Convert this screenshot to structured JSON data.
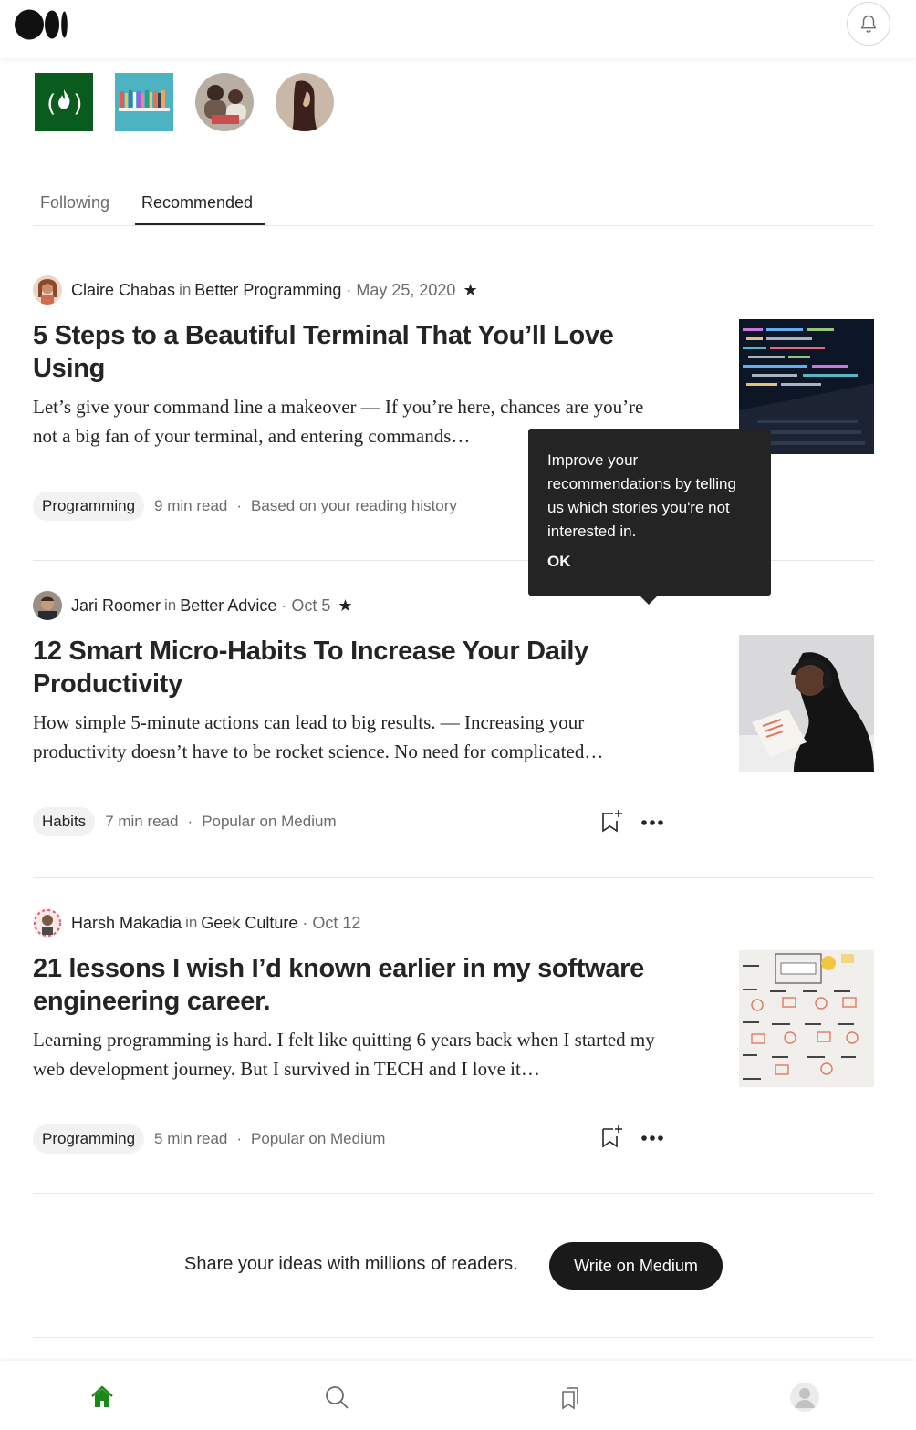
{
  "nav": {
    "icons": [
      "medium-logo-icon",
      "bell-icon"
    ]
  },
  "following_avatars": [
    {
      "name": "freecodecamp-avatar",
      "color": "#0a5c1e"
    },
    {
      "name": "bookshelf-avatar",
      "color": "#4db3c0"
    },
    {
      "name": "people-photo-avatar",
      "color": "#8b7e74"
    },
    {
      "name": "woman-photo-avatar",
      "color": "#6b4a3f"
    }
  ],
  "tabs": [
    {
      "label": "Following",
      "active": false
    },
    {
      "label": "Recommended",
      "active": true
    }
  ],
  "articles": [
    {
      "author": "Claire Chabas",
      "in": "in",
      "publication": "Better Programming",
      "date": "May 25, 2020",
      "star": "★",
      "title": "5 Steps to a Beautiful Terminal That You’ll Love Using",
      "excerpt": "Let’s give your command line a makeover — If you’re here, chances are you’re not a big fan of your terminal, and entering commands…",
      "tag": "Programming",
      "read_time": "9 min read",
      "reason": "Based on your reading history"
    },
    {
      "author": "Jari Roomer",
      "in": "in",
      "publication": "Better Advice",
      "date": "Oct 5",
      "star": "★",
      "title": "12 Smart Micro-Habits To Increase Your Daily Productivity",
      "excerpt": "How simple 5-minute actions can lead to big results. — Increasing your productivity doesn’t have to be rocket science. No need for complicated…",
      "tag": "Habits",
      "read_time": "7 min read",
      "reason": "Popular on Medium"
    },
    {
      "author": "Harsh Makadia",
      "in": "in",
      "publication": "Geek Culture",
      "date": "Oct 12",
      "star": "",
      "title": "21 lessons I wish I’d known earlier in my software engineering career.",
      "excerpt": "Learning programming is hard. I felt like quitting 6 years back when I started my web development journey. But I survived in TECH and I love it…",
      "tag": "Programming",
      "read_time": "5 min read",
      "reason": "Popular on Medium"
    }
  ],
  "tooltip": {
    "text": "Improve your recommendations by telling us which stories you're not interested in.",
    "ok": "OK"
  },
  "cta": {
    "text": "Share your ideas with millions of readers.",
    "button": "Write on Medium"
  },
  "bottom_nav": {
    "items": [
      "home-icon",
      "search-icon",
      "bookmarks-icon",
      "profile-icon"
    ],
    "active_color": "#1a8917"
  }
}
